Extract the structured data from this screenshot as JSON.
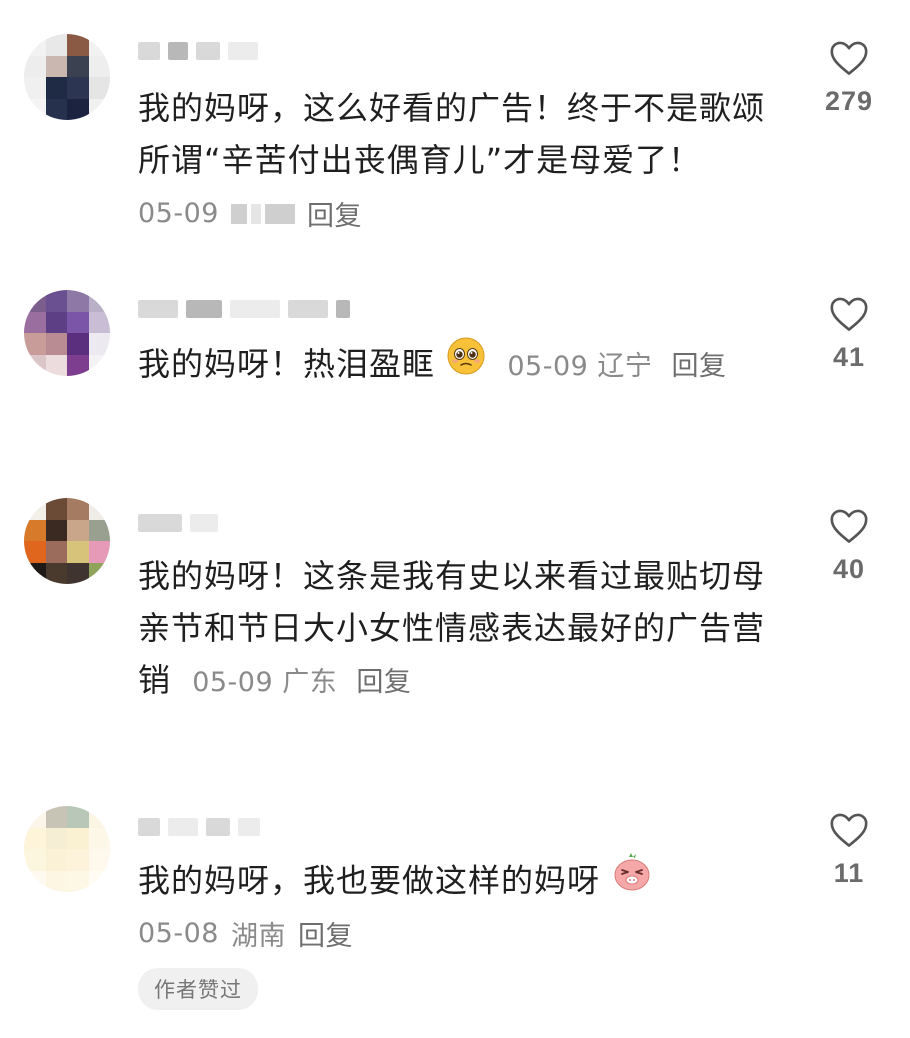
{
  "comments": [
    {
      "text": "我的妈呀，这么好看的广告！终于不是歌颂所谓“辛苦付出丧偶育儿”才是母爱了！",
      "date": "05-09",
      "location": "",
      "reply_label": "回复",
      "likes": "279"
    },
    {
      "text": "我的妈呀！热泪盈眶",
      "emoji": "teary-face-emoji",
      "date": "05-09",
      "location": "辽宁",
      "reply_label": "回复",
      "likes": "41"
    },
    {
      "text": "我的妈呀！这条是我有史以来看过最贴切母亲节和节日大小女性情感表达最好的广告营销",
      "date": "05-09",
      "location": "广东",
      "reply_label": "回复",
      "likes": "40"
    },
    {
      "text": "我的妈呀，我也要做这样的妈呀",
      "emoji": "pink-pig-emoji",
      "date": "05-08",
      "location": "湖南",
      "reply_label": "回复",
      "likes": "11",
      "badge": "作者赞过"
    }
  ],
  "icons": {
    "like": "heart-outline-icon"
  },
  "colors": {
    "text": "#1f1f1f",
    "meta": "#8a8a8a",
    "like_count": "#6b6b6b",
    "badge_bg": "#f0f0f0"
  }
}
